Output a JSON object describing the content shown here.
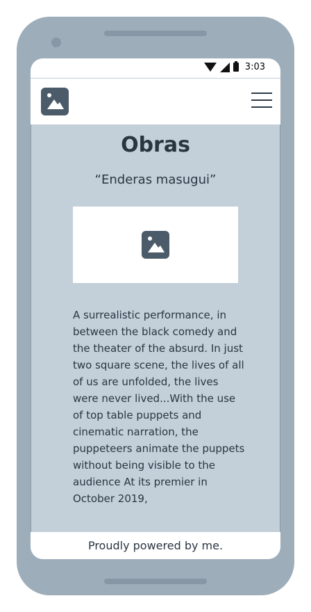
{
  "status_bar": {
    "time": "3:03",
    "icons": [
      "wifi-icon",
      "signal-icon",
      "battery-icon"
    ]
  },
  "header": {
    "logo_icon": "image-placeholder-icon",
    "menu_icon": "hamburger-menu-icon"
  },
  "main": {
    "title": "Obras",
    "subtitle": "“Enderas masugui”",
    "image_icon": "image-placeholder-icon",
    "body_text": "A surrealistic performance, in between the black comedy and the theater of the absurd. In just two square scene, the lives of all of us are unfolded, the lives were never lived...With the use of top table puppets and cinematic narration, the puppeteers animate the puppets without being visible to the audience At its premier in October 2019,"
  },
  "footer": {
    "text": "Proudly powered by me."
  },
  "colors": {
    "phone_frame": "#9eadba",
    "screen_bg": "#c3cfd9",
    "icon_bg": "#4b5b69",
    "text": "#2a3540"
  }
}
